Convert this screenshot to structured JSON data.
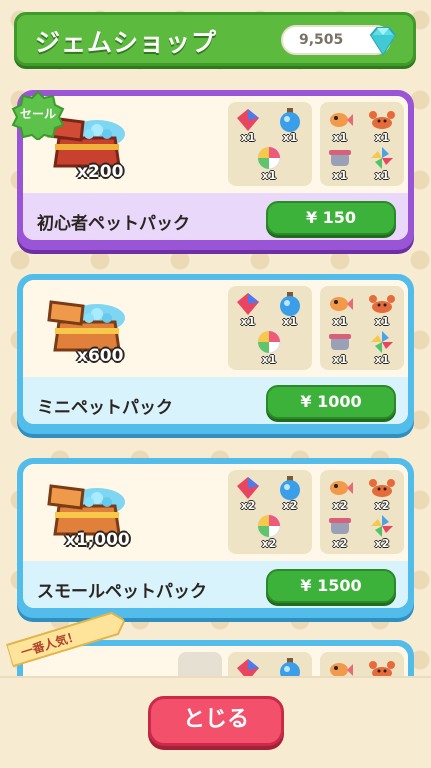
{
  "header": {
    "title": "ジェムショップ",
    "gem_count": "9,505",
    "icon": "diamond-icon"
  },
  "packs": [
    {
      "name": "初心者ペットパック",
      "price": "¥ 150",
      "gem_amount": "x200",
      "badge": "セール",
      "theme": "purple",
      "items_left": [
        {
          "icon": "crystal-icon",
          "qty": "x1"
        },
        {
          "icon": "potion-icon",
          "qty": "x1"
        },
        {
          "icon": "candy-icon",
          "qty": "x1"
        }
      ],
      "items_right": [
        {
          "icon": "fish-icon",
          "qty": "x1"
        },
        {
          "icon": "crab-icon",
          "qty": "x1"
        },
        {
          "icon": "pot-icon",
          "qty": "x1"
        },
        {
          "icon": "pinwheel-icon",
          "qty": "x1"
        }
      ]
    },
    {
      "name": "ミニペットパック",
      "price": "¥ 1000",
      "gem_amount": "x600",
      "theme": "blue",
      "items_left": [
        {
          "icon": "crystal-icon",
          "qty": "x1"
        },
        {
          "icon": "potion-icon",
          "qty": "x1"
        },
        {
          "icon": "candy-icon",
          "qty": "x1"
        }
      ],
      "items_right": [
        {
          "icon": "fish-icon",
          "qty": "x1"
        },
        {
          "icon": "crab-icon",
          "qty": "x1"
        },
        {
          "icon": "pot-icon",
          "qty": "x1"
        },
        {
          "icon": "pinwheel-icon",
          "qty": "x1"
        }
      ]
    },
    {
      "name": "スモールペットパック",
      "price": "¥ 1500",
      "gem_amount": "x1,000",
      "theme": "blue",
      "items_left": [
        {
          "icon": "crystal-icon",
          "qty": "x2"
        },
        {
          "icon": "potion-icon",
          "qty": "x2"
        },
        {
          "icon": "candy-icon",
          "qty": "x2"
        }
      ],
      "items_right": [
        {
          "icon": "fish-icon",
          "qty": "x2"
        },
        {
          "icon": "crab-icon",
          "qty": "x2"
        },
        {
          "icon": "pot-icon",
          "qty": "x2"
        },
        {
          "icon": "pinwheel-icon",
          "qty": "x2"
        }
      ]
    }
  ],
  "partial_pack": {
    "ribbon": "一番人気！"
  },
  "close_button": "とじる",
  "colors": {
    "header_green": "#5cbb3f",
    "purple_card": "#9a55d6",
    "blue_card": "#52bdea",
    "buy_green": "#3cb23a",
    "close_pink": "#f2506b"
  }
}
